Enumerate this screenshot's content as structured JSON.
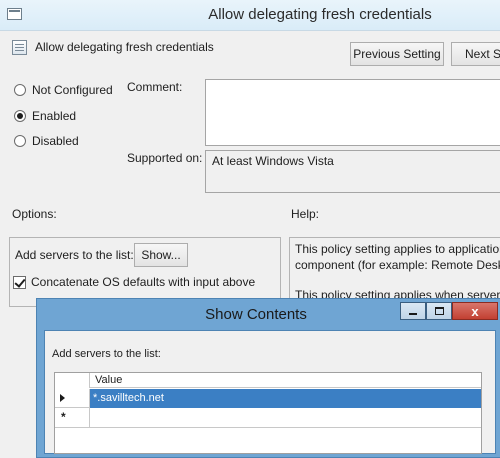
{
  "main_window": {
    "title": "Allow delegating fresh credentials",
    "policy_name": "Allow delegating fresh credentials",
    "buttons": {
      "previous": "Previous Setting",
      "next": "Next Se"
    },
    "state_options": [
      {
        "label": "Not Configured",
        "selected": false
      },
      {
        "label": "Enabled",
        "selected": true
      },
      {
        "label": "Disabled",
        "selected": false
      }
    ],
    "comment_label": "Comment:",
    "comment_value": "",
    "supported_label": "Supported on:",
    "supported_value": "At least Windows Vista",
    "options_label": "Options:",
    "help_label": "Help:",
    "options": {
      "add_servers_label": "Add servers to the list:",
      "show_button": "Show...",
      "concatenate_label": "Concatenate OS defaults with input above",
      "concatenate_checked": true
    },
    "help_text": [
      "This policy setting applies to applications u",
      "component (for example: Remote Desktop",
      "This policy setting applies when server auth"
    ]
  },
  "dialog": {
    "title": "Show Contents",
    "close_glyph": "x",
    "list_label": "Add servers to the list:",
    "column_header": "Value",
    "rows": [
      {
        "value": "*.savilltech.net",
        "selected": true
      }
    ],
    "new_row_marker": "*"
  },
  "colors": {
    "dialog_frame": "#6fa5d3",
    "selection": "#3b7fc4",
    "close_button": "#c94a3c"
  }
}
